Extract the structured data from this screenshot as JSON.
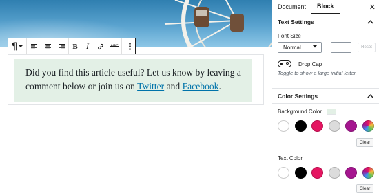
{
  "toolbar": {
    "icons": [
      "paragraph-icon",
      "chevron-down-icon",
      "align-left-icon",
      "align-center-icon",
      "align-right-icon",
      "bold-icon",
      "italic-icon",
      "link-icon",
      "strikethrough-icon",
      "more-options-icon"
    ],
    "paragraph_glyph": "¶",
    "bold_glyph": "B",
    "italic_glyph": "I",
    "strike_glyph": "ABC"
  },
  "paragraph": {
    "text_before": "Did you find this article useful? Let us know by leaving a comment below or join us on ",
    "link1": "Twitter",
    "text_middle": " and ",
    "link2": "Facebook",
    "text_after": ".",
    "background_color": "#e3f0e6",
    "link_color": "#0073aa"
  },
  "sidebar": {
    "tabs": [
      {
        "label": "Document",
        "active": false
      },
      {
        "label": "Block",
        "active": true
      }
    ],
    "close_glyph": "✕",
    "text_settings": {
      "title": "Text Settings",
      "font_size_label": "Font Size",
      "font_size_value": "Normal",
      "reset_label": "Reset",
      "drop_cap_label": "Drop Cap",
      "drop_cap_help": "Toggle to show a large initial letter."
    },
    "color_settings": {
      "title": "Color Settings",
      "background_label": "Background Color",
      "text_label": "Text Color",
      "clear_label": "Clear",
      "palette": [
        "#ffffff",
        "#000000",
        "#e51561",
        "#dcdcdc",
        "#a5158f",
        "gradient"
      ]
    },
    "chevron_glyph": "︿"
  }
}
